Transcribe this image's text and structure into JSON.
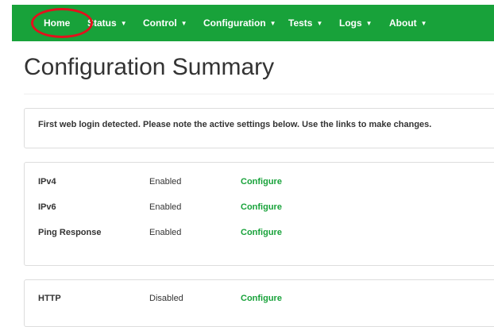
{
  "nav": {
    "items": [
      {
        "label": "Home",
        "dropdown": false
      },
      {
        "label": "Status",
        "dropdown": true
      },
      {
        "label": "Control",
        "dropdown": true
      },
      {
        "label": "Configuration",
        "dropdown": true
      },
      {
        "label": "Tests",
        "dropdown": true
      },
      {
        "label": "Logs",
        "dropdown": true
      },
      {
        "label": "About",
        "dropdown": true
      }
    ],
    "caret": "▼",
    "color": "#18a23a",
    "highlight_color": "#e4101c"
  },
  "page": {
    "title": "Configuration Summary"
  },
  "notice": {
    "text": "First web login detected. Please note the active settings below. Use the links to make changes."
  },
  "settings": [
    {
      "name": "IPv4",
      "status": "Enabled",
      "action": "Configure"
    },
    {
      "name": "IPv6",
      "status": "Enabled",
      "action": "Configure"
    },
    {
      "name": "Ping Response",
      "status": "Enabled",
      "action": "Configure"
    }
  ],
  "settings2": [
    {
      "name": "HTTP",
      "status": "Disabled",
      "action": "Configure"
    }
  ]
}
